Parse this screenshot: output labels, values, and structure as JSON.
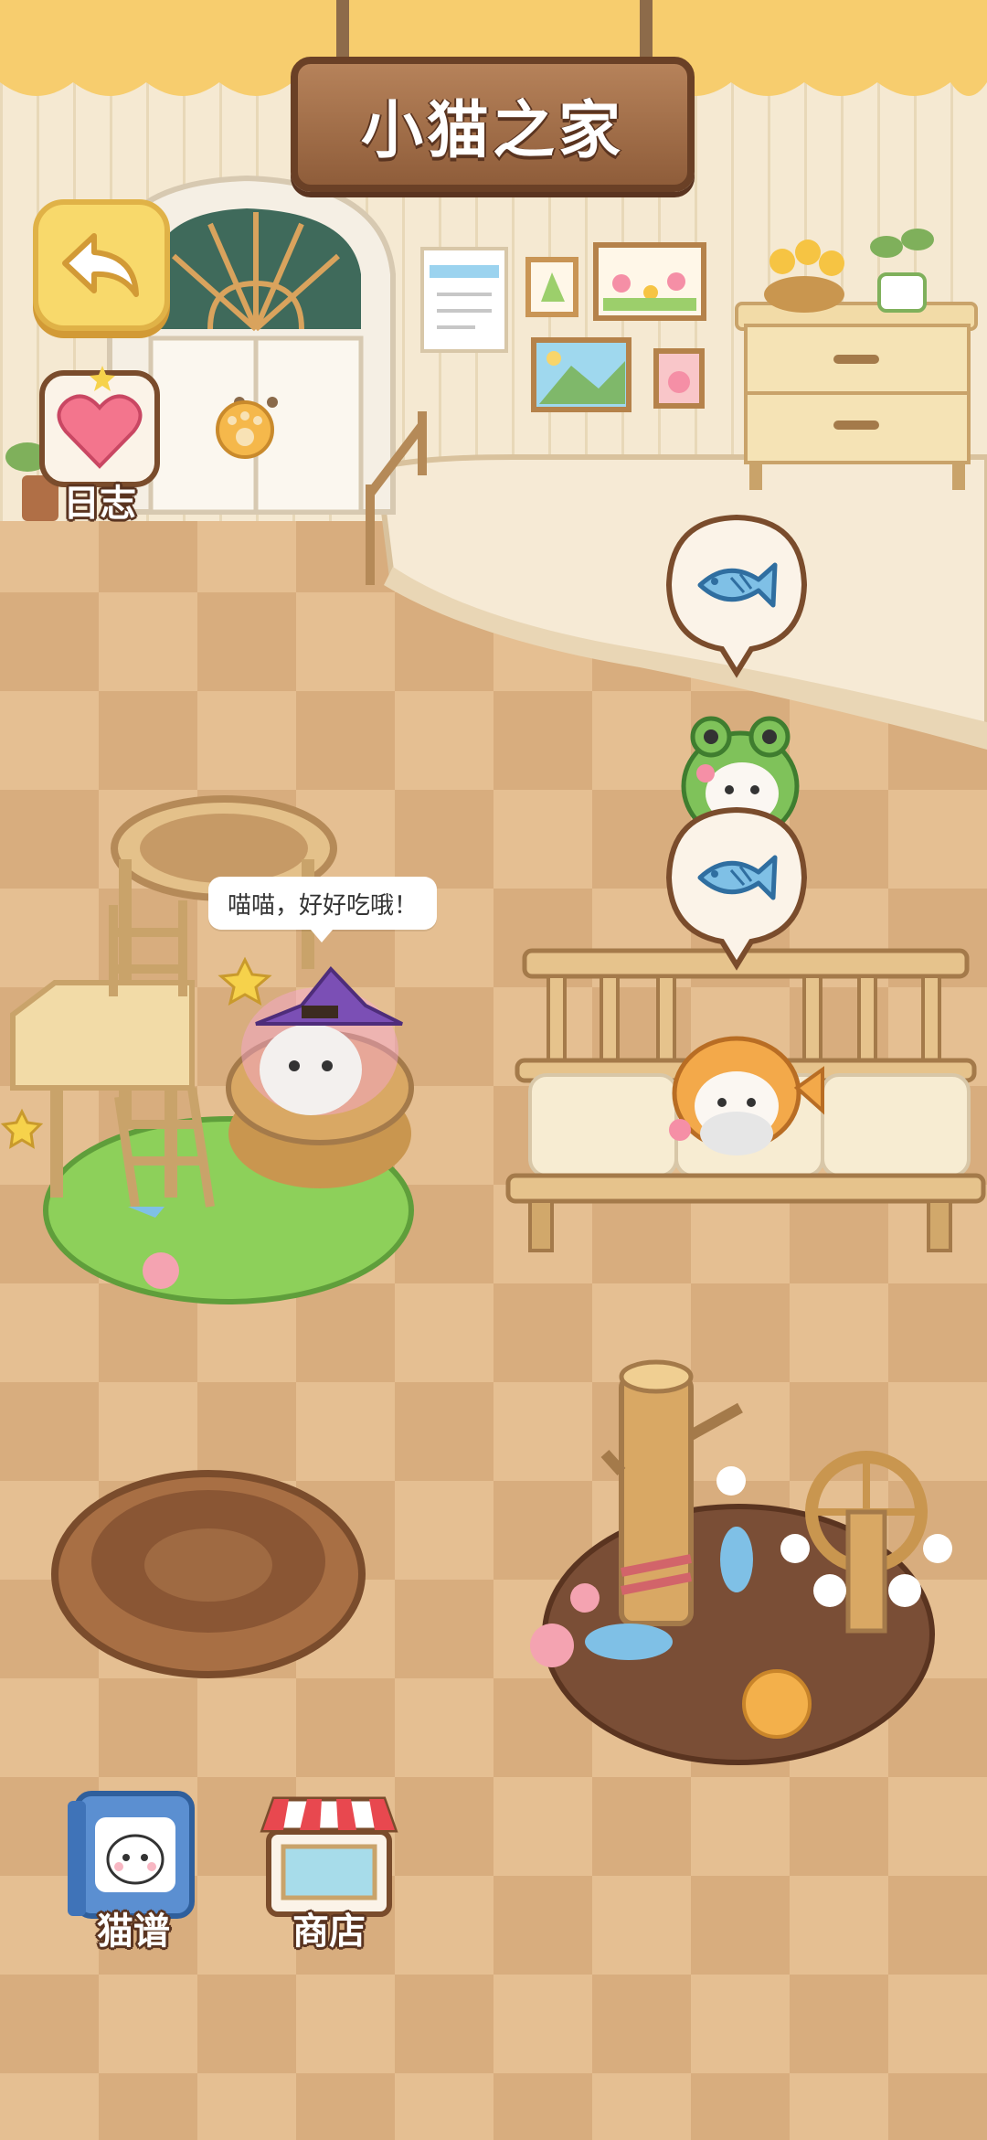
{
  "header": {
    "title": "小猫之家"
  },
  "buttons": {
    "back_icon": "back-arrow-icon",
    "journal_label": "日志",
    "catalog_label": "猫谱",
    "shop_label": "商店"
  },
  "cat_speech": "喵喵，好好吃哦！",
  "bubbles": [
    {
      "icon": "fish-icon"
    },
    {
      "icon": "fish-icon"
    }
  ],
  "colors": {
    "floor_light": "#eccfa6",
    "floor_dark": "#ddb586",
    "wall": "#f4e7cf",
    "sign_wood": "#a4714b",
    "button_yellow": "#f8d96b",
    "grass": "#8dd05a"
  }
}
